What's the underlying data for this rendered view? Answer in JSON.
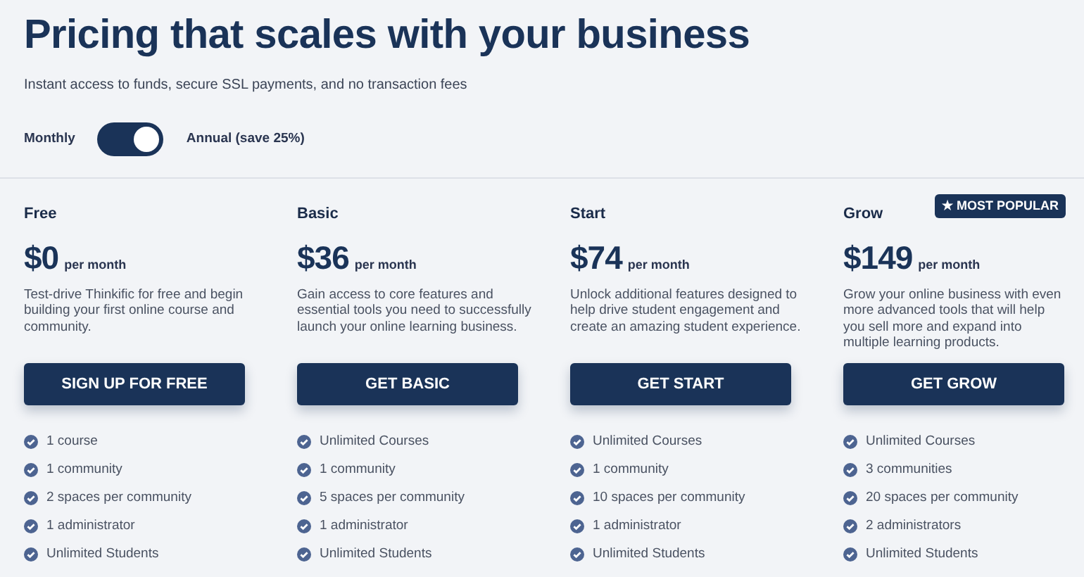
{
  "title": "Pricing that scales with your business",
  "subtitle": "Instant access to funds, secure SSL payments, and no transaction fees",
  "billing_toggle": {
    "left_label": "Monthly",
    "right_label": "Annual (save 25%)",
    "on": true
  },
  "plans": [
    {
      "name": "Free",
      "price": "$0",
      "period": "per month",
      "description": "Test-drive Thinkific for free and begin building your first online course and community.",
      "button": "SIGN UP FOR FREE",
      "features": [
        "1 course",
        "1 community",
        "2 spaces per community",
        "1 administrator",
        "Unlimited Students"
      ]
    },
    {
      "name": "Basic",
      "price": "$36",
      "period": "per month",
      "description": "Gain access to core features and essential tools you need to successfully launch your online learning business.",
      "button": "GET BASIC",
      "features": [
        "Unlimited Courses",
        "1 community",
        "5 spaces per community",
        "1 administrator",
        "Unlimited Students"
      ]
    },
    {
      "name": "Start",
      "price": "$74",
      "period": "per month",
      "description": "Unlock additional features designed to help drive student engagement and create an amazing student experience.",
      "button": "GET START",
      "features": [
        "Unlimited Courses",
        "1 community",
        "10 spaces per community",
        "1 administrator",
        "Unlimited Students"
      ]
    },
    {
      "name": "Grow",
      "badge": "★ MOST POPULAR",
      "price": "$149",
      "period": "per month",
      "description": "Grow your online business with even more advanced tools that will help you sell more and expand into multiple learning products.",
      "button": "GET GROW",
      "features": [
        "Unlimited Courses",
        "3 communities",
        "20 spaces per community",
        "2 administrators",
        "Unlimited Students"
      ]
    }
  ]
}
